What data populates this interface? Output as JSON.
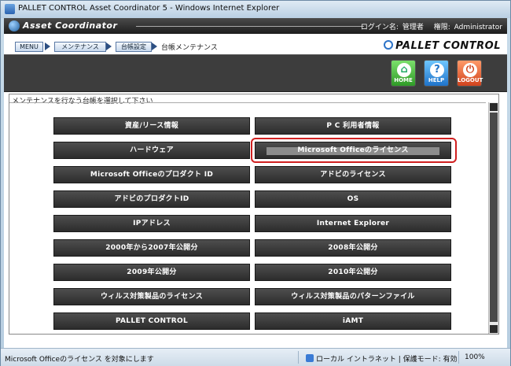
{
  "window": {
    "title": "PALLET CONTROL Asset Coordinator 5 - Windows Internet Explorer"
  },
  "header": {
    "app_name": "Asset Coordinator",
    "login_label": "ログイン名:",
    "login_value": "管理者",
    "role_label": "権限:",
    "role_value": "Administrator"
  },
  "breadcrumb": {
    "items": [
      "MENU",
      "メンテナンス",
      "台帳設定"
    ],
    "current": "台帳メンテナンス"
  },
  "brand": "PALLET CONTROL",
  "toolbar": {
    "home": "HOME",
    "help": "HELP",
    "logout": "LOGOUT"
  },
  "panel": {
    "caption": "メンテナンスを行なう台帳を選択して下さい"
  },
  "ledgers": {
    "left": [
      "資産/リース情報",
      "ハードウェア",
      "Microsoft Officeのプロダクト ID",
      "アドビのプロダクトID",
      "IPアドレス",
      "2000年から2007年公開分",
      "2009年公開分",
      "ウィルス対策製品のライセンス",
      "PALLET CONTROL"
    ],
    "right": [
      "P C 利用者情報",
      "Microsoft Officeのライセンス",
      "アドビのライセンス",
      "OS",
      "Internet Explorer",
      "2008年公開分",
      "2010年公開分",
      "ウィルス対策製品のパターンファイル",
      "iAMT"
    ],
    "selected": "Microsoft Officeのライセンス"
  },
  "status": {
    "text": "Microsoft Officeのライセンス を対象にします",
    "zone": "ローカル イントラネット | 保護モード: 有効",
    "zoom": "100%"
  },
  "colors": {
    "button_bg": "#3a3a3a",
    "highlight": "#d02020",
    "home": "#2f9a27",
    "help": "#1f73c9",
    "logout": "#d1431d"
  }
}
